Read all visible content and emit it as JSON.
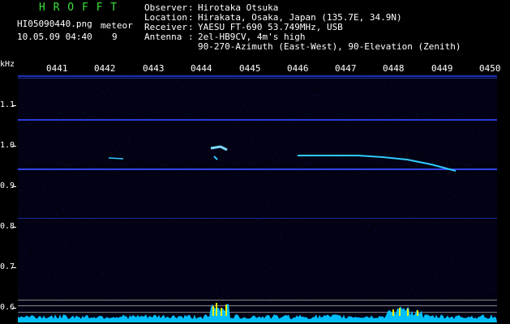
{
  "app": {
    "title": "H R O F F T",
    "filename": "HI05090440.png",
    "datetime": "10.05.09 04:40",
    "meteor_label": "meteor",
    "meteor_count": "9"
  },
  "info": {
    "observer_key": "Observer",
    "observer_val": "Hirotaka Otsuka",
    "location_key": "Location",
    "location_val": "Hirakata, Osaka, Japan (135.7E, 34.9N)",
    "receiver_key": "Receiver",
    "receiver_val": "YAESU FT-690 53.749MHz, USB",
    "antenna_key": "Antenna",
    "antenna_val1": "2el-HB9CV, 4m's high",
    "antenna_val2": "90-270-Azimuth (East-West), 90-Elevation (Zenith)"
  },
  "axis": {
    "y_unit": "kHz",
    "y_ticks": [
      "1.1",
      "1.0",
      "0.9",
      "0.8",
      "0.7",
      "0.6"
    ],
    "x_ticks": [
      "0441",
      "0442",
      "0443",
      "0444",
      "0445",
      "0446",
      "0447",
      "0448",
      "0449",
      "0450"
    ]
  },
  "colors": {
    "accent": "#39e23a",
    "signal": "#2fc9ff",
    "band": "#2b3bd9",
    "noise": "#00bfff",
    "burst": "#f0f000"
  }
}
